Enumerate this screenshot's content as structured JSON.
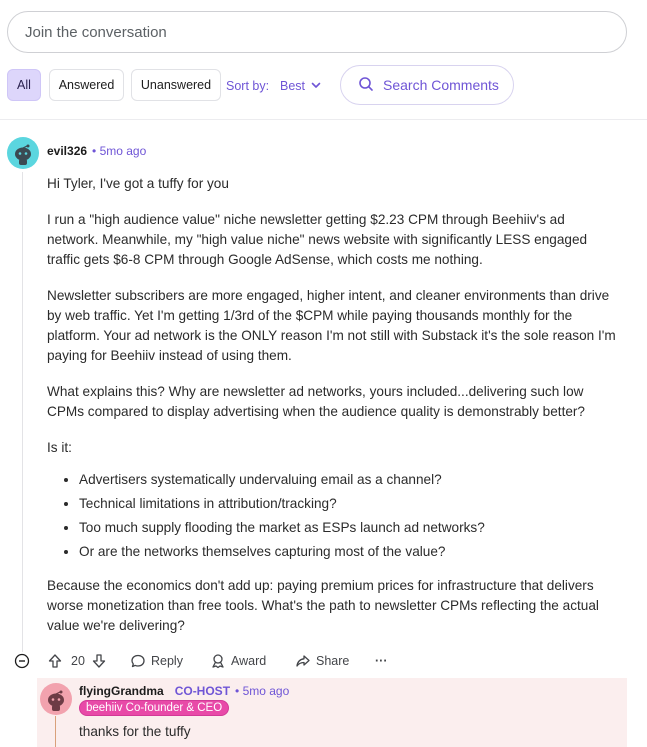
{
  "composer": {
    "placeholder": "Join the conversation"
  },
  "filters": {
    "chips": [
      "All",
      "Answered",
      "Unanswered"
    ],
    "sort_label": "Sort by:",
    "sort_value": "Best",
    "search_label": "Search Comments"
  },
  "comment": {
    "author": "evil326",
    "time": "• 5mo ago",
    "paragraphs": [
      "Hi Tyler, I've got a tuffy for you",
      "I run a \"high audience value\" niche newsletter getting $2.23 CPM through Beehiiv's ad network. Meanwhile, my \"high value niche\" news website with significantly LESS engaged traffic gets $6-8 CPM through Google AdSense, which costs me nothing.",
      "Newsletter subscribers are more engaged, higher intent, and cleaner environments than drive by web traffic. Yet I'm getting 1/3rd of the $CPM while paying thousands monthly for the platform. Your ad network is the ONLY reason I'm not still with Substack it's the sole reason I'm paying for Beehiiv instead of using them.",
      "What explains this? Why are newsletter ad networks, yours included...delivering such low CPMs compared to display advertising when the audience quality is demonstrably better?",
      "Is it:"
    ],
    "bullets": [
      "Advertisers systematically undervaluing email as a channel?",
      "Technical limitations in attribution/tracking?",
      "Too much supply flooding the market as ESPs launch ad networks?",
      "Or are the networks themselves capturing most of the value?"
    ],
    "closing": "Because the economics don't add up: paying premium prices for infrastructure that delivers worse monetization than free tools. What's the path to newsletter CPMs reflecting the actual value we're delivering?",
    "actions": {
      "votes": "20",
      "reply": "Reply",
      "award": "Award",
      "share": "Share",
      "more": "···"
    }
  },
  "reply": {
    "author": "flyingGrandma",
    "role": "CO-HOST",
    "time": "• 5mo ago",
    "badge": "beehiiv Co-founder & CEO",
    "text": "thanks for the tuffy"
  },
  "colors": {
    "accent": "#6f55d6",
    "active_chip": "#ddd6fb",
    "badge": "#e84aa8",
    "reply_bg": "#fbeeee"
  }
}
